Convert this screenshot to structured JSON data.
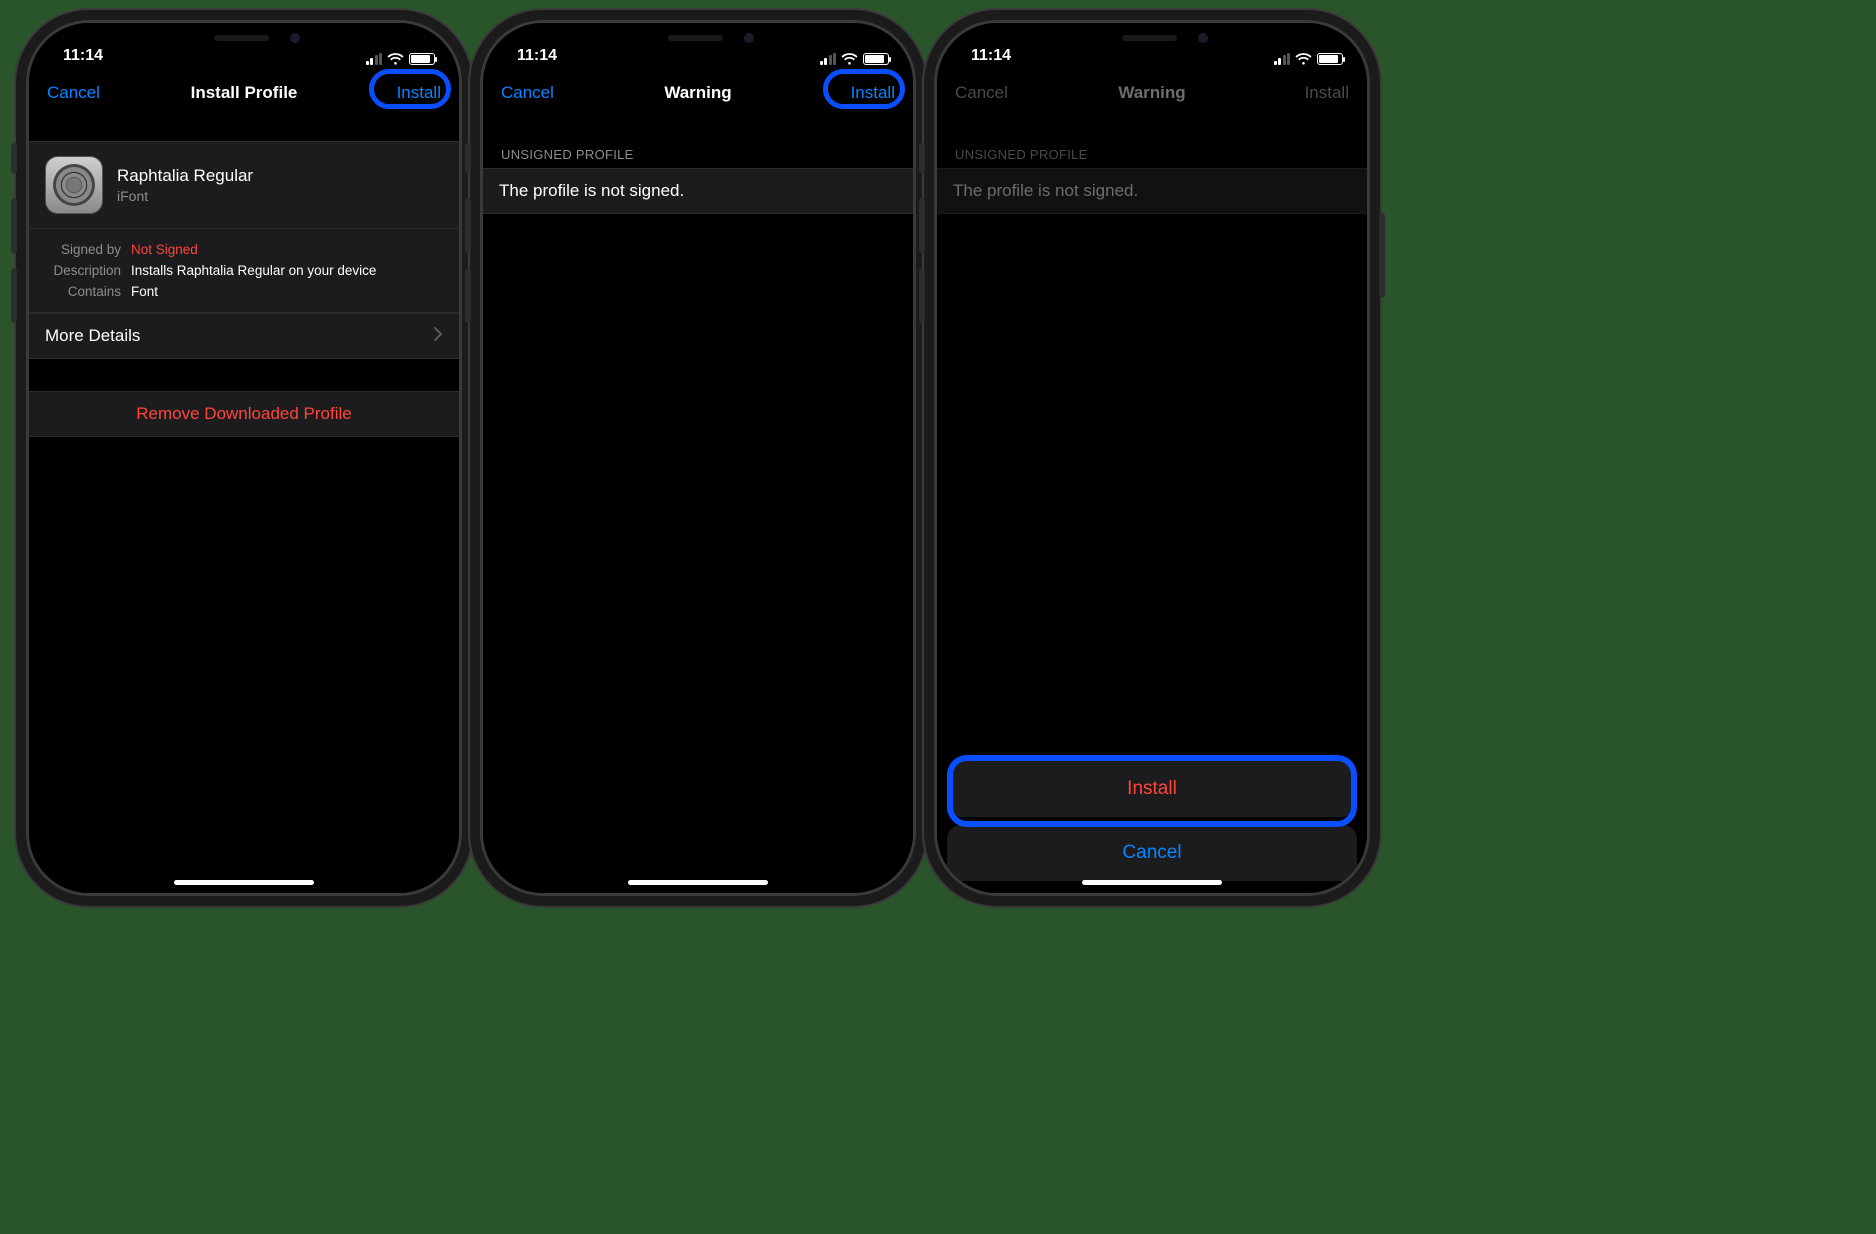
{
  "status": {
    "time": "11:14"
  },
  "screen1": {
    "nav": {
      "cancel": "Cancel",
      "title": "Install Profile",
      "install": "Install"
    },
    "profile": {
      "title": "Raphtalia Regular",
      "subtitle": "iFont"
    },
    "meta": {
      "signed_label": "Signed by",
      "signed_value": "Not Signed",
      "desc_label": "Description",
      "desc_value": "Installs Raphtalia Regular on your device",
      "contains_label": "Contains",
      "contains_value": "Font"
    },
    "more": "More Details",
    "remove": "Remove Downloaded Profile"
  },
  "screen2": {
    "nav": {
      "cancel": "Cancel",
      "title": "Warning",
      "install": "Install"
    },
    "section": "UNSIGNED PROFILE",
    "message": "The profile is not signed."
  },
  "screen3": {
    "nav": {
      "cancel": "Cancel",
      "title": "Warning",
      "install": "Install"
    },
    "section": "UNSIGNED PROFILE",
    "message": "The profile is not signed.",
    "sheet": {
      "install": "Install",
      "cancel": "Cancel"
    }
  }
}
